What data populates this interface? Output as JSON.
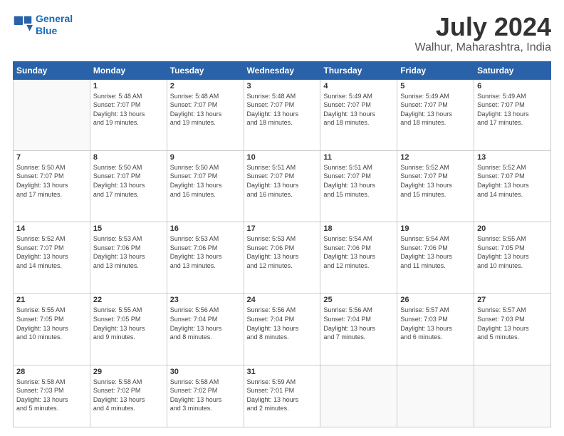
{
  "logo": {
    "line1": "General",
    "line2": "Blue"
  },
  "title": "July 2024",
  "subtitle": "Walhur, Maharashtra, India",
  "days_header": [
    "Sunday",
    "Monday",
    "Tuesday",
    "Wednesday",
    "Thursday",
    "Friday",
    "Saturday"
  ],
  "weeks": [
    [
      {
        "day": "",
        "info": ""
      },
      {
        "day": "1",
        "info": "Sunrise: 5:48 AM\nSunset: 7:07 PM\nDaylight: 13 hours\nand 19 minutes."
      },
      {
        "day": "2",
        "info": "Sunrise: 5:48 AM\nSunset: 7:07 PM\nDaylight: 13 hours\nand 19 minutes."
      },
      {
        "day": "3",
        "info": "Sunrise: 5:48 AM\nSunset: 7:07 PM\nDaylight: 13 hours\nand 18 minutes."
      },
      {
        "day": "4",
        "info": "Sunrise: 5:49 AM\nSunset: 7:07 PM\nDaylight: 13 hours\nand 18 minutes."
      },
      {
        "day": "5",
        "info": "Sunrise: 5:49 AM\nSunset: 7:07 PM\nDaylight: 13 hours\nand 18 minutes."
      },
      {
        "day": "6",
        "info": "Sunrise: 5:49 AM\nSunset: 7:07 PM\nDaylight: 13 hours\nand 17 minutes."
      }
    ],
    [
      {
        "day": "7",
        "info": "Sunrise: 5:50 AM\nSunset: 7:07 PM\nDaylight: 13 hours\nand 17 minutes."
      },
      {
        "day": "8",
        "info": "Sunrise: 5:50 AM\nSunset: 7:07 PM\nDaylight: 13 hours\nand 17 minutes."
      },
      {
        "day": "9",
        "info": "Sunrise: 5:50 AM\nSunset: 7:07 PM\nDaylight: 13 hours\nand 16 minutes."
      },
      {
        "day": "10",
        "info": "Sunrise: 5:51 AM\nSunset: 7:07 PM\nDaylight: 13 hours\nand 16 minutes."
      },
      {
        "day": "11",
        "info": "Sunrise: 5:51 AM\nSunset: 7:07 PM\nDaylight: 13 hours\nand 15 minutes."
      },
      {
        "day": "12",
        "info": "Sunrise: 5:52 AM\nSunset: 7:07 PM\nDaylight: 13 hours\nand 15 minutes."
      },
      {
        "day": "13",
        "info": "Sunrise: 5:52 AM\nSunset: 7:07 PM\nDaylight: 13 hours\nand 14 minutes."
      }
    ],
    [
      {
        "day": "14",
        "info": "Sunrise: 5:52 AM\nSunset: 7:07 PM\nDaylight: 13 hours\nand 14 minutes."
      },
      {
        "day": "15",
        "info": "Sunrise: 5:53 AM\nSunset: 7:06 PM\nDaylight: 13 hours\nand 13 minutes."
      },
      {
        "day": "16",
        "info": "Sunrise: 5:53 AM\nSunset: 7:06 PM\nDaylight: 13 hours\nand 13 minutes."
      },
      {
        "day": "17",
        "info": "Sunrise: 5:53 AM\nSunset: 7:06 PM\nDaylight: 13 hours\nand 12 minutes."
      },
      {
        "day": "18",
        "info": "Sunrise: 5:54 AM\nSunset: 7:06 PM\nDaylight: 13 hours\nand 12 minutes."
      },
      {
        "day": "19",
        "info": "Sunrise: 5:54 AM\nSunset: 7:06 PM\nDaylight: 13 hours\nand 11 minutes."
      },
      {
        "day": "20",
        "info": "Sunrise: 5:55 AM\nSunset: 7:05 PM\nDaylight: 13 hours\nand 10 minutes."
      }
    ],
    [
      {
        "day": "21",
        "info": "Sunrise: 5:55 AM\nSunset: 7:05 PM\nDaylight: 13 hours\nand 10 minutes."
      },
      {
        "day": "22",
        "info": "Sunrise: 5:55 AM\nSunset: 7:05 PM\nDaylight: 13 hours\nand 9 minutes."
      },
      {
        "day": "23",
        "info": "Sunrise: 5:56 AM\nSunset: 7:04 PM\nDaylight: 13 hours\nand 8 minutes."
      },
      {
        "day": "24",
        "info": "Sunrise: 5:56 AM\nSunset: 7:04 PM\nDaylight: 13 hours\nand 8 minutes."
      },
      {
        "day": "25",
        "info": "Sunrise: 5:56 AM\nSunset: 7:04 PM\nDaylight: 13 hours\nand 7 minutes."
      },
      {
        "day": "26",
        "info": "Sunrise: 5:57 AM\nSunset: 7:03 PM\nDaylight: 13 hours\nand 6 minutes."
      },
      {
        "day": "27",
        "info": "Sunrise: 5:57 AM\nSunset: 7:03 PM\nDaylight: 13 hours\nand 5 minutes."
      }
    ],
    [
      {
        "day": "28",
        "info": "Sunrise: 5:58 AM\nSunset: 7:03 PM\nDaylight: 13 hours\nand 5 minutes."
      },
      {
        "day": "29",
        "info": "Sunrise: 5:58 AM\nSunset: 7:02 PM\nDaylight: 13 hours\nand 4 minutes."
      },
      {
        "day": "30",
        "info": "Sunrise: 5:58 AM\nSunset: 7:02 PM\nDaylight: 13 hours\nand 3 minutes."
      },
      {
        "day": "31",
        "info": "Sunrise: 5:59 AM\nSunset: 7:01 PM\nDaylight: 13 hours\nand 2 minutes."
      },
      {
        "day": "",
        "info": ""
      },
      {
        "day": "",
        "info": ""
      },
      {
        "day": "",
        "info": ""
      }
    ]
  ]
}
